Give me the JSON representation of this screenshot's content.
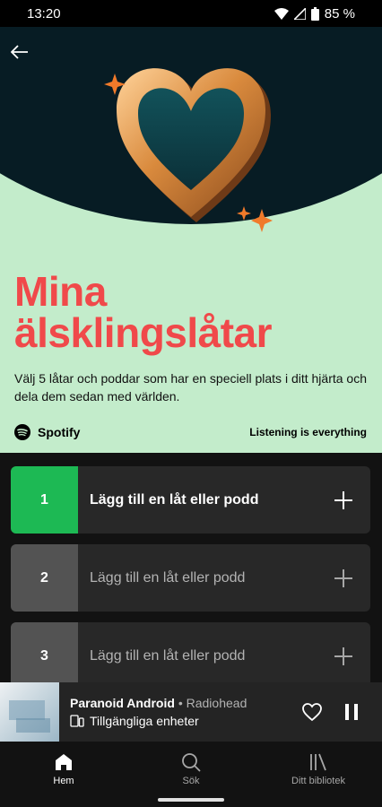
{
  "status": {
    "time": "13:20",
    "battery": "85 %"
  },
  "hero": {
    "title_line1": "Mina",
    "title_line2": "älsklingslåtar",
    "subtitle": "Välj 5 låtar och poddar som har en speciell plats i ditt hjärta och dela dem sedan med världen.",
    "brand": "Spotify",
    "tagline": "Listening is everything"
  },
  "slots": [
    {
      "number": "1",
      "label": "Lägg till en låt eller podd"
    },
    {
      "number": "2",
      "label": "Lägg till en låt eller podd"
    },
    {
      "number": "3",
      "label": "Lägg till en låt eller podd"
    }
  ],
  "player": {
    "title": "Paranoid Android",
    "separator": " • ",
    "artist": "Radiohead",
    "device": "Tillgängliga enheter"
  },
  "nav": [
    {
      "label": "Hem",
      "icon": "home-icon"
    },
    {
      "label": "Sök",
      "icon": "search-icon"
    },
    {
      "label": "Ditt bibliotek",
      "icon": "library-icon"
    }
  ],
  "colors": {
    "accent_green": "#1db954",
    "title_red": "#f0494a",
    "hero_bg": "#c3eccb"
  }
}
